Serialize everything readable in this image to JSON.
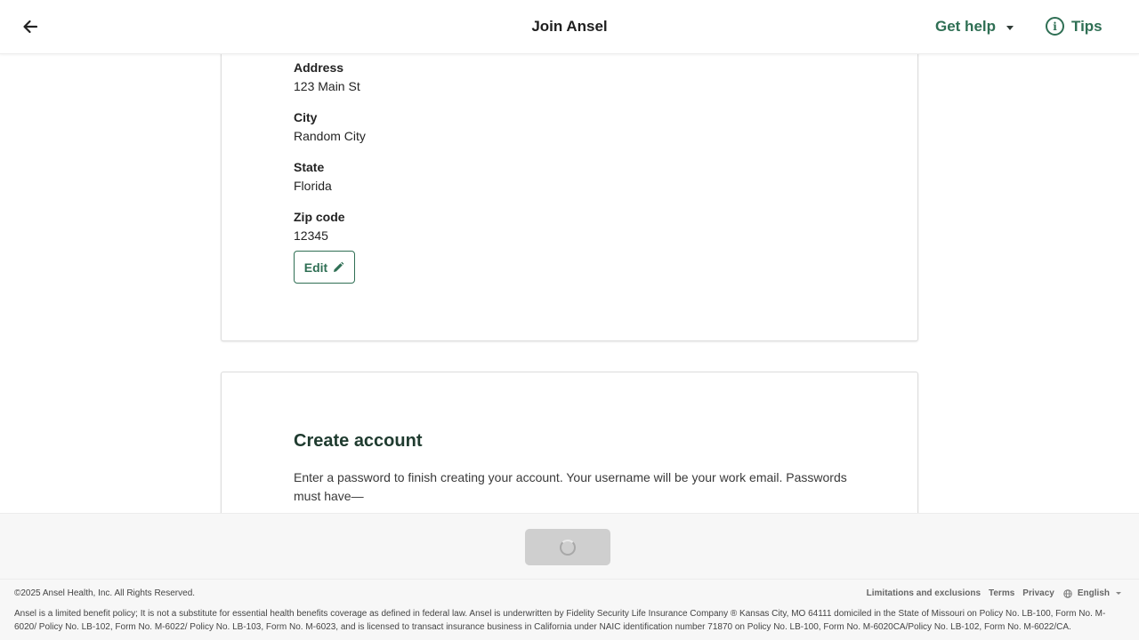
{
  "header": {
    "title": "Join Ansel",
    "get_help_label": "Get help",
    "tips_label": "Tips"
  },
  "address_card": {
    "fields": [
      {
        "label": "Address",
        "value": "123 Main St"
      },
      {
        "label": "City",
        "value": "Random City"
      },
      {
        "label": "State",
        "value": "Florida"
      },
      {
        "label": "Zip code",
        "value": "12345"
      }
    ],
    "edit_label": "Edit"
  },
  "create_account": {
    "title": "Create account",
    "description": "Enter a password to finish creating your account. Your username will be your work email. Passwords must have—"
  },
  "footer": {
    "copyright": "©2025 Ansel Health, Inc. All Rights Reserved.",
    "links": [
      "Limitations and exclusions",
      "Terms",
      "Privacy"
    ],
    "language": "English",
    "disclaimer": "Ansel is a limited benefit policy; It is not a substitute for essential health benefits coverage as defined in federal law. Ansel is underwritten by Fidelity Security Life Insurance Company ® Kansas City, MO 64111 domiciled in the State of Missouri on Policy No. LB-100, Form No. M-6020/ Policy No. LB-102, Form No. M-6022/ Policy No. LB-103, Form No. M-6023, and is licensed to transact insurance business in California under NAIC identification number 71870 on Policy No. LB-100, Form No. M-6020CA/Policy No. LB-102, Form No. M-6022/CA."
  },
  "colors": {
    "brand_green": "#2f6f54",
    "heading_dark_green": "#1f3b2f",
    "disabled_button": "#cfcfcf"
  },
  "icons": {
    "back": "arrow-left-icon",
    "get_help_caret": "chevron-down-icon",
    "tips": "info-icon",
    "edit": "pencil-icon",
    "loading": "spinner-icon",
    "language": "globe-icon"
  }
}
